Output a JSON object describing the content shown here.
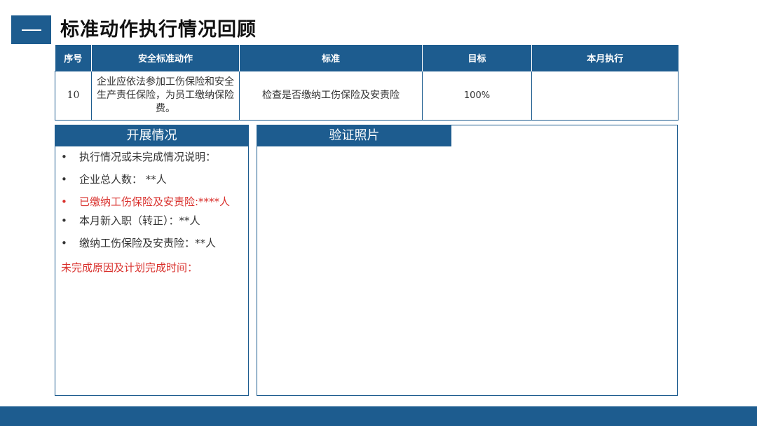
{
  "title": "标准动作执行情况回顾",
  "table": {
    "headers": [
      "序号",
      "安全标准动作",
      "标准",
      "目标",
      "本月执行"
    ],
    "row": {
      "no": "10",
      "action": "企业应依法参加工伤保险和安全生产责任保险，为员工缴纳保险费。",
      "standard": "检查是否缴纳工伤保险及安责险",
      "target": "100%",
      "execution": ""
    }
  },
  "left_panel": {
    "title": "开展情况",
    "bullet": "•",
    "items": [
      "执行情况或未完成情况说明：",
      "企业总人数： **人",
      "已缴纳工伤保险及安责险:****人",
      "本月新入职（转正）：**人",
      "缴纳工伤保险及安责险：**人"
    ],
    "note": "未完成原因及计划完成时间："
  },
  "right_panel": {
    "title": "验证照片"
  },
  "colors": {
    "primary": "#1d5c8f",
    "highlight": "#d9302c"
  }
}
